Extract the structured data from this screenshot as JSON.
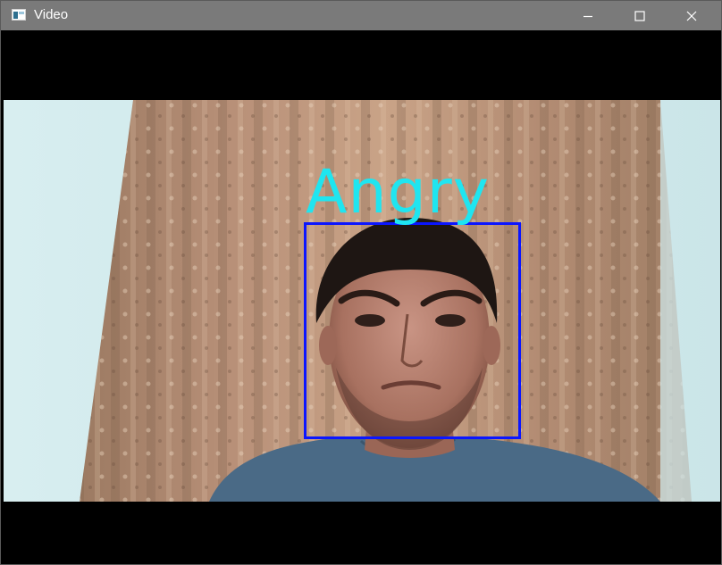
{
  "window": {
    "title": "Video",
    "icon": "app-window-icon"
  },
  "controls": {
    "minimize": "minimize-icon",
    "maximize": "maximize-icon",
    "close": "close-icon"
  },
  "detection": {
    "emotion_label": "Angry",
    "label_color": "#1fe5f0",
    "box_color": "#0b16ff"
  }
}
